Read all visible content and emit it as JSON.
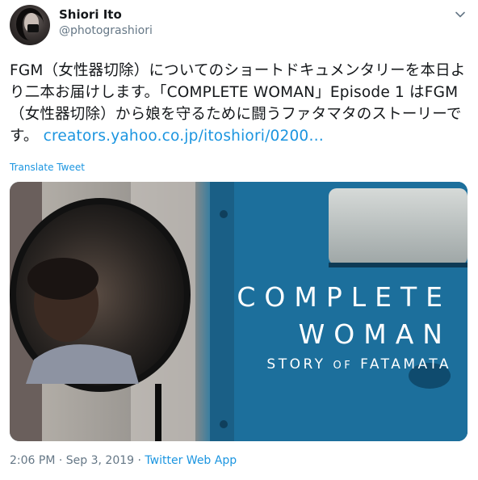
{
  "user": {
    "display_name": "Shiori Ito",
    "handle": "@photograshiori"
  },
  "tweet": {
    "text_main": "FGM（女性器切除）についてのショートドキュメンタリーを本日より二本お届けします。「COMPLETE WOMAN」Episode 1 はFGM（女性器切除）から娘を守るために闘うファタマタのストーリーです。",
    "link_text": "creators.yahoo.co.jp/itoshiori/0200…",
    "translate_label": "Translate Tweet"
  },
  "media": {
    "title_line1": "COMPLETE",
    "title_line2": "WOMAN",
    "subtitle_story": "STORY ",
    "subtitle_of": "OF",
    "subtitle_name": " FATAMATA"
  },
  "meta": {
    "time": "2:06 PM",
    "separator1": " · ",
    "date": "Sep 3, 2019",
    "separator2": " · ",
    "app": "Twitter Web App"
  },
  "colors": {
    "link": "#1b95e0",
    "muted": "#657786",
    "text": "#14171a"
  }
}
